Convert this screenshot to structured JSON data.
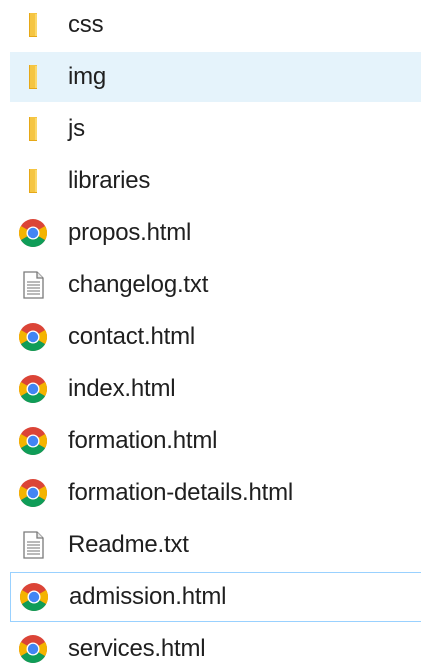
{
  "files": [
    {
      "name": "css",
      "type": "folder",
      "icon": "folder-icon"
    },
    {
      "name": "img",
      "type": "folder",
      "icon": "folder-icon",
      "state": "hovered"
    },
    {
      "name": "js",
      "type": "folder",
      "icon": "folder-icon"
    },
    {
      "name": "libraries",
      "type": "folder",
      "icon": "folder-icon"
    },
    {
      "name": "propos.html",
      "type": "html",
      "icon": "chrome-icon"
    },
    {
      "name": "changelog.txt",
      "type": "text",
      "icon": "text-file-icon"
    },
    {
      "name": "contact.html",
      "type": "html",
      "icon": "chrome-icon"
    },
    {
      "name": "index.html",
      "type": "html",
      "icon": "chrome-icon"
    },
    {
      "name": "formation.html",
      "type": "html",
      "icon": "chrome-icon"
    },
    {
      "name": "formation-details.html",
      "type": "html",
      "icon": "chrome-icon"
    },
    {
      "name": "Readme.txt",
      "type": "text",
      "icon": "text-file-icon"
    },
    {
      "name": "admission.html",
      "type": "html",
      "icon": "chrome-icon",
      "state": "focused"
    },
    {
      "name": "services.html",
      "type": "html",
      "icon": "chrome-icon"
    }
  ],
  "colors": {
    "hover_background": "#e5f3fb",
    "focus_border": "#99d1ff",
    "folder": "#f5c542",
    "chrome_red": "#db4437",
    "chrome_yellow": "#f4b400",
    "chrome_green": "#0f9d58",
    "chrome_blue": "#4285f4"
  }
}
